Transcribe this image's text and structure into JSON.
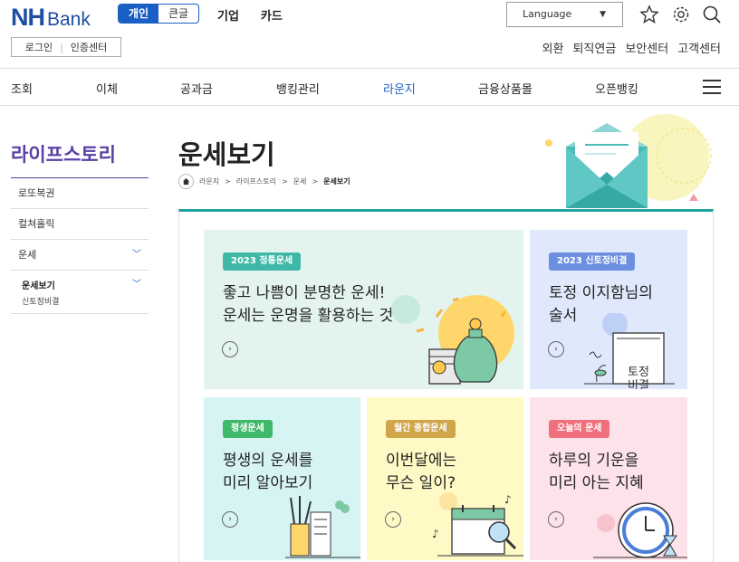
{
  "header": {
    "logo_nh": "NH",
    "logo_bank": "Bank",
    "segments": [
      "개인",
      "큰글"
    ],
    "top_nav": [
      "기업",
      "카드"
    ],
    "language_label": "Language",
    "utility": [
      "외환",
      "퇴직연금",
      "보안센터",
      "고객센터"
    ],
    "login": "로그인",
    "cert": "인증센터"
  },
  "gnb": [
    "조회",
    "이체",
    "공과금",
    "뱅킹관리",
    "라운지",
    "금융상품몰",
    "오픈뱅킹"
  ],
  "sidebar": {
    "title": "라이프스토리",
    "items": [
      "로또복권",
      "컬쳐홀릭",
      "운세"
    ],
    "sub_active": "운세보기",
    "sub_child": "신토정비결"
  },
  "page": {
    "title": "운세보기",
    "breadcrumb": [
      "라운지",
      "라이프스토리",
      "운세",
      "운세보기"
    ]
  },
  "cards": [
    {
      "badge": "2023 정통운세",
      "line1": "좋고 나쁨이 분명한 운세!",
      "line2": "운세는 운명을 활용하는 것"
    },
    {
      "badge": "2023 신토정비결",
      "line1": "토정 이지함님의",
      "line2": "술서",
      "book_text1": "토정",
      "book_text2": "비결"
    },
    {
      "badge": "평생운세",
      "line1": "평생의 운세를",
      "line2": "미리 알아보기"
    },
    {
      "badge": "월간 종합운세",
      "line1": "이번달에는",
      "line2": "무슨 일이?"
    },
    {
      "badge": "오늘의 운세",
      "line1": "하루의 기운을",
      "line2": "미리 아는 지혜"
    }
  ],
  "colors": {
    "brand": "#1d4fa3",
    "accent_teal": "#20a39e",
    "sidebar_purple": "#5b3fa6"
  }
}
